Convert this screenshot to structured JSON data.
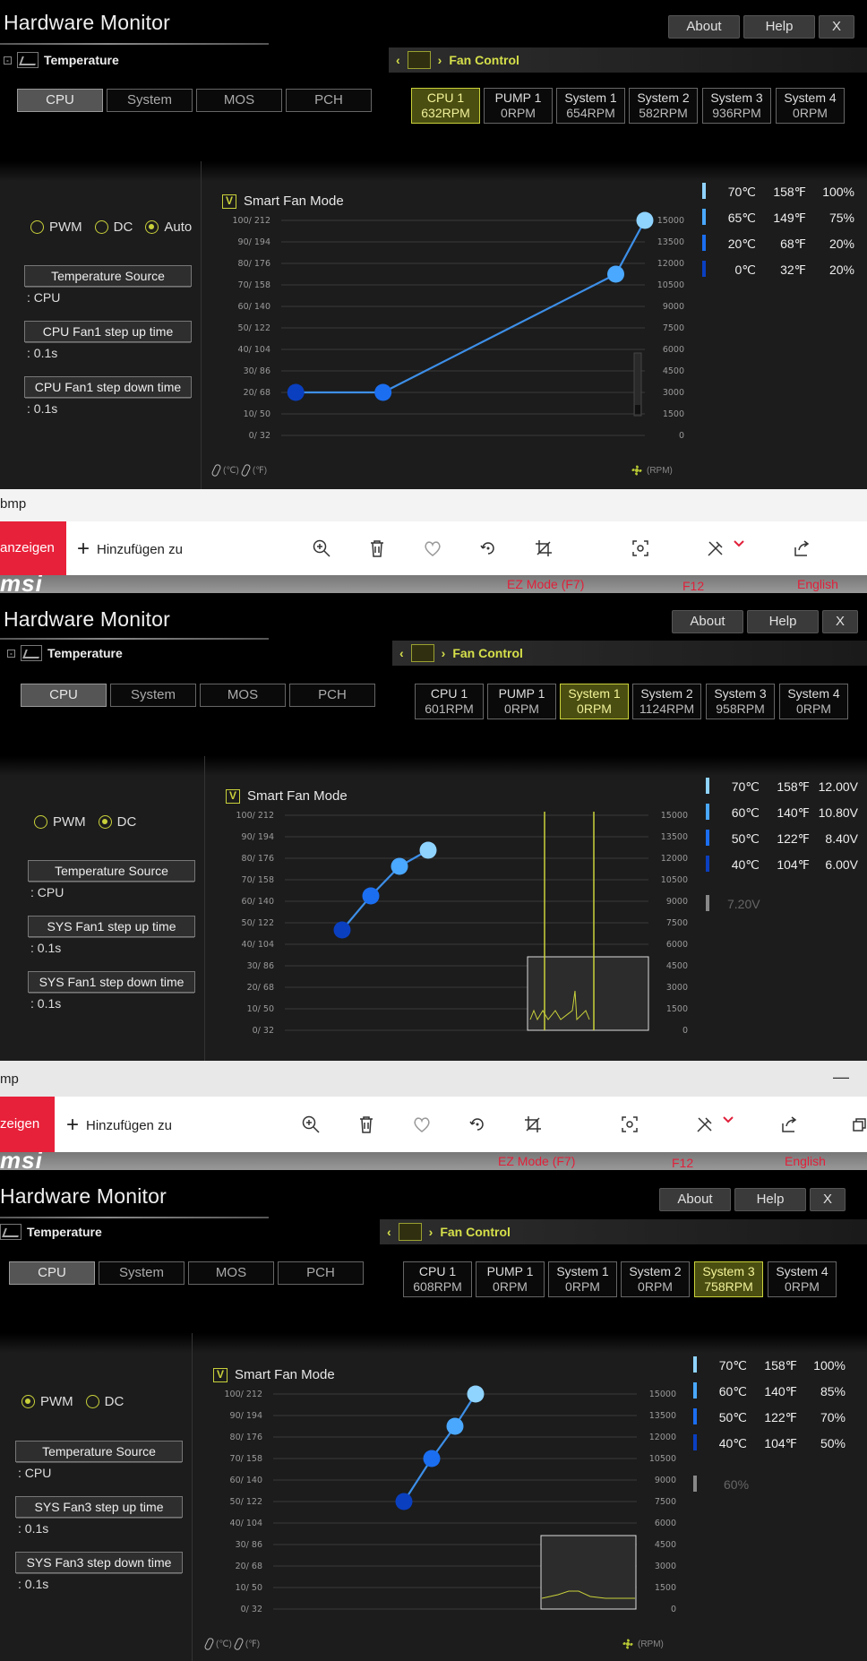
{
  "p1": {
    "title": "Hardware Monitor",
    "about": "About",
    "help": "Help",
    "close": "X",
    "temperature": "Temperature",
    "fan_control": "Fan Control",
    "temp_tabs": [
      "CPU",
      "System",
      "MOS",
      "PCH"
    ],
    "fans": [
      {
        "name": "CPU 1",
        "rpm": "632RPM"
      },
      {
        "name": "PUMP 1",
        "rpm": "0RPM"
      },
      {
        "name": "System 1",
        "rpm": "654RPM"
      },
      {
        "name": "System 2",
        "rpm": "582RPM"
      },
      {
        "name": "System 3",
        "rpm": "936RPM"
      },
      {
        "name": "System 4",
        "rpm": "0RPM"
      }
    ],
    "active_fan": 0,
    "modes": [
      "PWM",
      "DC",
      "Auto"
    ],
    "selected_mode": "Auto",
    "temp_source_label": "Temperature Source",
    "temp_source_value": ": CPU",
    "step_up_label": "CPU Fan1 step up time",
    "step_up_value": ": 0.1s",
    "step_down_label": "CPU Fan1 step down time",
    "step_down_value": ": 0.1s",
    "smart_fan": "Smart Fan Mode",
    "check": "V",
    "legend": [
      {
        "c": "70℃",
        "f": "158℉",
        "v": "100%",
        "color": "#8fd3ff"
      },
      {
        "c": "65℃",
        "f": "149℉",
        "v": "75%",
        "color": "#4aa8ff"
      },
      {
        "c": "20℃",
        "f": "68℉",
        "v": "20%",
        "color": "#1b6ef0"
      },
      {
        "c": "0℃",
        "f": "32℉",
        "v": "20%",
        "color": "#0a3fc0"
      }
    ],
    "units_temp_c": "(℃)",
    "units_temp_f": "(℉)",
    "units_rpm": "(RPM)"
  },
  "photos1": {
    "title": "bmp",
    "red_button": "anzeigen",
    "add": "Hinzufügen zu",
    "ez_mode": "EZ Mode (F7)",
    "f12": "F12",
    "english": "English",
    "minimize": ""
  },
  "p2": {
    "title": "Hardware Monitor",
    "about": "About",
    "help": "Help",
    "close": "X",
    "temperature": "Temperature",
    "fan_control": "Fan Control",
    "temp_tabs": [
      "CPU",
      "System",
      "MOS",
      "PCH"
    ],
    "fans": [
      {
        "name": "CPU 1",
        "rpm": "601RPM"
      },
      {
        "name": "PUMP 1",
        "rpm": "0RPM"
      },
      {
        "name": "System 1",
        "rpm": "0RPM"
      },
      {
        "name": "System 2",
        "rpm": "1124RPM"
      },
      {
        "name": "System 3",
        "rpm": "958RPM"
      },
      {
        "name": "System 4",
        "rpm": "0RPM"
      }
    ],
    "active_fan": 2,
    "modes": [
      "PWM",
      "DC"
    ],
    "selected_mode": "DC",
    "temp_source_label": "Temperature Source",
    "temp_source_value": ": CPU",
    "step_up_label": "SYS Fan1 step up time",
    "step_up_value": ": 0.1s",
    "step_down_label": "SYS Fan1 step down time",
    "step_down_value": ": 0.1s",
    "smart_fan": "Smart Fan Mode",
    "check": "V",
    "legend": [
      {
        "c": "70℃",
        "f": "158℉",
        "v": "12.00V",
        "color": "#8fd3ff"
      },
      {
        "c": "60℃",
        "f": "140℉",
        "v": "10.80V",
        "color": "#4aa8ff"
      },
      {
        "c": "50℃",
        "f": "122℉",
        "v": "8.40V",
        "color": "#1b6ef0"
      },
      {
        "c": "40℃",
        "f": "104℉",
        "v": "6.00V",
        "color": "#0a3fc0"
      }
    ],
    "current_value": "7.20V"
  },
  "photos2": {
    "title": "mp",
    "red_button": "zeigen",
    "add": "Hinzufügen zu",
    "ez_mode": "EZ Mode (F7)",
    "f12": "F12",
    "english": "English",
    "minimize": "—"
  },
  "p3": {
    "title": "Hardware Monitor",
    "about": "About",
    "help": "Help",
    "close": "X",
    "temperature": "Temperature",
    "fan_control": "Fan Control",
    "temp_tabs": [
      "CPU",
      "System",
      "MOS",
      "PCH"
    ],
    "fans": [
      {
        "name": "CPU 1",
        "rpm": "608RPM"
      },
      {
        "name": "PUMP 1",
        "rpm": "0RPM"
      },
      {
        "name": "System 1",
        "rpm": "0RPM"
      },
      {
        "name": "System 2",
        "rpm": "0RPM"
      },
      {
        "name": "System 3",
        "rpm": "758RPM"
      },
      {
        "name": "System 4",
        "rpm": "0RPM"
      }
    ],
    "active_fan": 4,
    "modes": [
      "PWM",
      "DC"
    ],
    "selected_mode": "PWM",
    "temp_source_label": "Temperature Source",
    "temp_source_value": ": CPU",
    "step_up_label": "SYS Fan3 step up time",
    "step_up_value": ": 0.1s",
    "step_down_label": "SYS Fan3 step down time",
    "step_down_value": ": 0.1s",
    "smart_fan": "Smart Fan Mode",
    "check": "V",
    "legend": [
      {
        "c": "70℃",
        "f": "158℉",
        "v": "100%",
        "color": "#8fd3ff"
      },
      {
        "c": "60℃",
        "f": "140℉",
        "v": "85%",
        "color": "#4aa8ff"
      },
      {
        "c": "50℃",
        "f": "122℉",
        "v": "70%",
        "color": "#1b6ef0"
      },
      {
        "c": "40℃",
        "f": "104℉",
        "v": "50%",
        "color": "#0a3fc0"
      }
    ],
    "current_value": "60%",
    "units_temp_c": "(℃)",
    "units_temp_f": "(℉)",
    "units_rpm": "(RPM)"
  },
  "axis": {
    "left_ticks": [
      "100/ 212",
      "90/ 194",
      "80/ 176",
      "70/ 158",
      "60/ 140",
      "50/ 122",
      "40/ 104",
      "30/  86",
      "20/  68",
      "10/  50",
      "0/  32"
    ],
    "right_ticks": [
      "15000",
      "13500",
      "12000",
      "10500",
      "9000",
      "7500",
      "6000",
      "4500",
      "3000",
      "1500",
      "0"
    ]
  },
  "chart_data": [
    {
      "type": "line",
      "series": [
        {
          "temp_c": [
            0,
            20,
            65,
            70
          ],
          "percent": [
            20,
            20,
            75,
            100
          ]
        }
      ],
      "ylim": [
        0,
        100
      ],
      "xlim": [
        0,
        100
      ]
    },
    {
      "type": "line",
      "series": [
        {
          "temp_c": [
            40,
            50,
            60,
            70
          ],
          "volts": [
            6.0,
            8.4,
            10.8,
            12.0
          ]
        }
      ],
      "xlim": [
        0,
        100
      ]
    },
    {
      "type": "line",
      "series": [
        {
          "temp_c": [
            40,
            50,
            60,
            70
          ],
          "percent": [
            50,
            70,
            85,
            100
          ]
        }
      ],
      "ylim": [
        0,
        100
      ],
      "xlim": [
        0,
        100
      ]
    }
  ]
}
